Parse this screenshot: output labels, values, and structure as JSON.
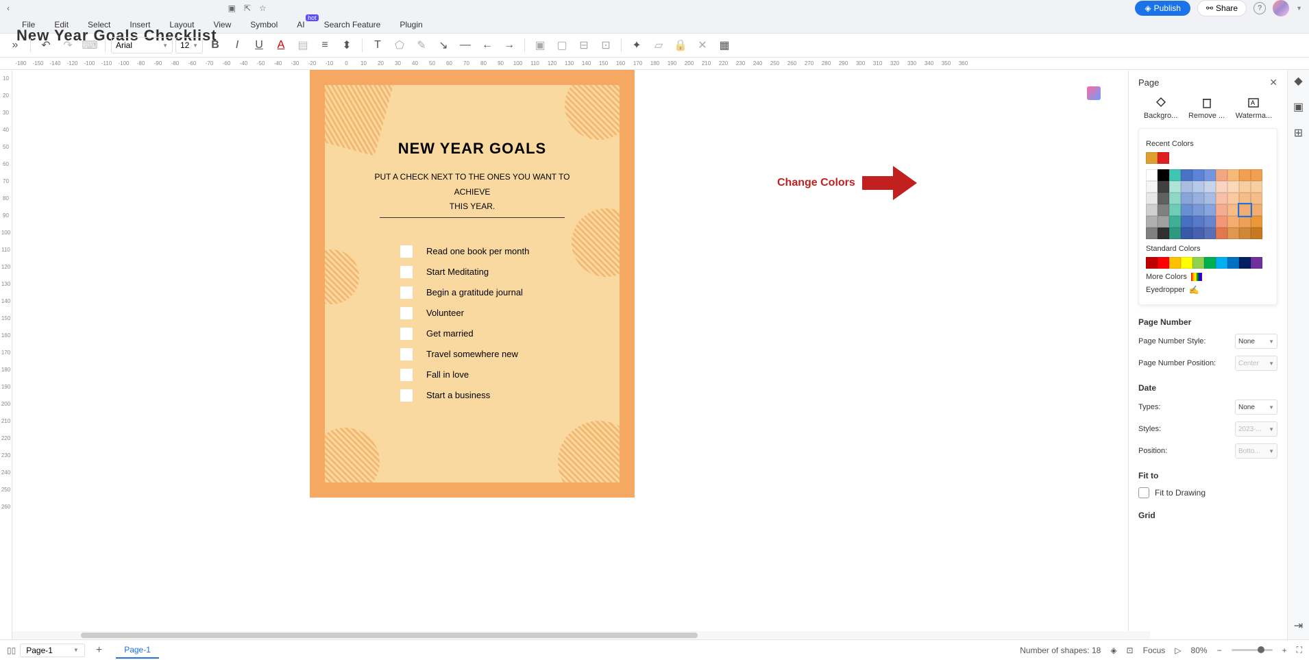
{
  "titlebar": {
    "doc_name": "New Year Goals Checklist",
    "publish": "Publish",
    "share": "Share"
  },
  "menubar": {
    "file": "File",
    "edit": "Edit",
    "select": "Select",
    "insert": "Insert",
    "layout": "Layout",
    "view": "View",
    "symbol": "Symbol",
    "ai": "AI",
    "ai_badge": "hot",
    "search_feature": "Search Feature",
    "plugin": "Plugin"
  },
  "toolbar": {
    "font": "Arial",
    "size": "12"
  },
  "ruler_h": [
    "-180",
    "-150",
    "-140",
    "-120",
    "-100",
    "-110",
    "-100",
    "-80",
    "-90",
    "-80",
    "-60",
    "-70",
    "-60",
    "-40",
    "-50",
    "-40",
    "-30",
    "-20",
    "-10",
    "0",
    "10",
    "20",
    "30",
    "40",
    "50",
    "60",
    "70",
    "80",
    "90",
    "100",
    "110",
    "120",
    "130",
    "140",
    "150",
    "160",
    "170",
    "180",
    "190",
    "200",
    "210",
    "220",
    "230",
    "240",
    "250",
    "260",
    "270",
    "280",
    "290",
    "300",
    "310",
    "320",
    "330",
    "340",
    "350",
    "360"
  ],
  "ruler_v": [
    "10",
    "20",
    "30",
    "40",
    "50",
    "60",
    "70",
    "80",
    "90",
    "100",
    "110",
    "120",
    "130",
    "140",
    "150",
    "160",
    "170",
    "180",
    "190",
    "200",
    "210",
    "220",
    "230",
    "240",
    "250",
    "260"
  ],
  "document": {
    "title": "NEW YEAR GOALS",
    "subtitle1": "PUT A CHECK NEXT TO THE ONES YOU WANT TO",
    "subtitle2": "ACHIEVE",
    "subtitle3": "THIS YEAR.",
    "items": [
      "Read one book per month",
      "Start Meditating",
      "Begin a gratitude journal",
      "Volunteer",
      "Get married",
      "Travel somewhere new",
      "Fall in love",
      "Start a business"
    ]
  },
  "annotation": {
    "text": "Change Colors"
  },
  "panel": {
    "title": "Page",
    "tab_background": "Backgro...",
    "tab_remove": "Remove ...",
    "tab_watermark": "Waterma...",
    "recent_colors": "Recent Colors",
    "recent_swatches": [
      "#e0a030",
      "#e02020"
    ],
    "theme_swatches": [
      [
        "#ffffff",
        "#000000",
        "#3ec6b0",
        "#4a72c4",
        "#5b84d8",
        "#7596dc",
        "#f4a582",
        "#f7b977",
        "#f0a050",
        "#f0a050"
      ],
      [
        "#f5f5f5",
        "#404040",
        "#aee3d8",
        "#a8bce4",
        "#b8c8e8",
        "#c8d4ec",
        "#fad4c0",
        "#fbd8b8",
        "#f8cda0",
        "#f8cda0"
      ],
      [
        "#e8e8e8",
        "#606060",
        "#8ed8c8",
        "#88a4d8",
        "#98b0e0",
        "#a8bce4",
        "#f8c0a8",
        "#f9caa0",
        "#f5bd88",
        "#f5bd88"
      ],
      [
        "#d0d0d0",
        "#808080",
        "#6ecdb8",
        "#6890d0",
        "#7898d8",
        "#88a4dc",
        "#f5ac90",
        "#f7bc88",
        "#f2ad70",
        "#f2ad70"
      ],
      [
        "#b0b0b0",
        "#a0a0a0",
        "#3eb098",
        "#4870c0",
        "#5878c8",
        "#6884cc",
        "#f29878",
        "#f5ae70",
        "#efa058",
        "#e89838"
      ],
      [
        "#808080",
        "#303030",
        "#2e9880",
        "#3858a8",
        "#4860b0",
        "#5870b8",
        "#e07850",
        "#e09850",
        "#d08838",
        "#c87820"
      ]
    ],
    "standard_colors": "Standard Colors",
    "standard_swatches": [
      "#c00000",
      "#ff0000",
      "#ffc000",
      "#ffff00",
      "#92d050",
      "#00b050",
      "#00b0f0",
      "#0070c0",
      "#002060",
      "#7030a0"
    ],
    "more_colors": "More Colors",
    "eyedropper": "Eyedropper",
    "page_number": "Page Number",
    "page_number_style": "Page Number Style:",
    "page_number_style_val": "None",
    "page_number_position": "Page Number Position:",
    "page_number_position_val": "Center",
    "date": "Date",
    "date_types": "Types:",
    "date_types_val": "None",
    "date_styles": "Styles:",
    "date_styles_val": "2023-...",
    "date_position": "Position:",
    "date_position_val": "Botto...",
    "fit_to": "Fit to",
    "fit_to_drawing": "Fit to Drawing",
    "grid": "Grid"
  },
  "statusbar": {
    "page_select": "Page-1",
    "page_tab": "Page-1",
    "shapes": "Number of shapes: 18",
    "focus": "Focus",
    "zoom": "80%"
  }
}
